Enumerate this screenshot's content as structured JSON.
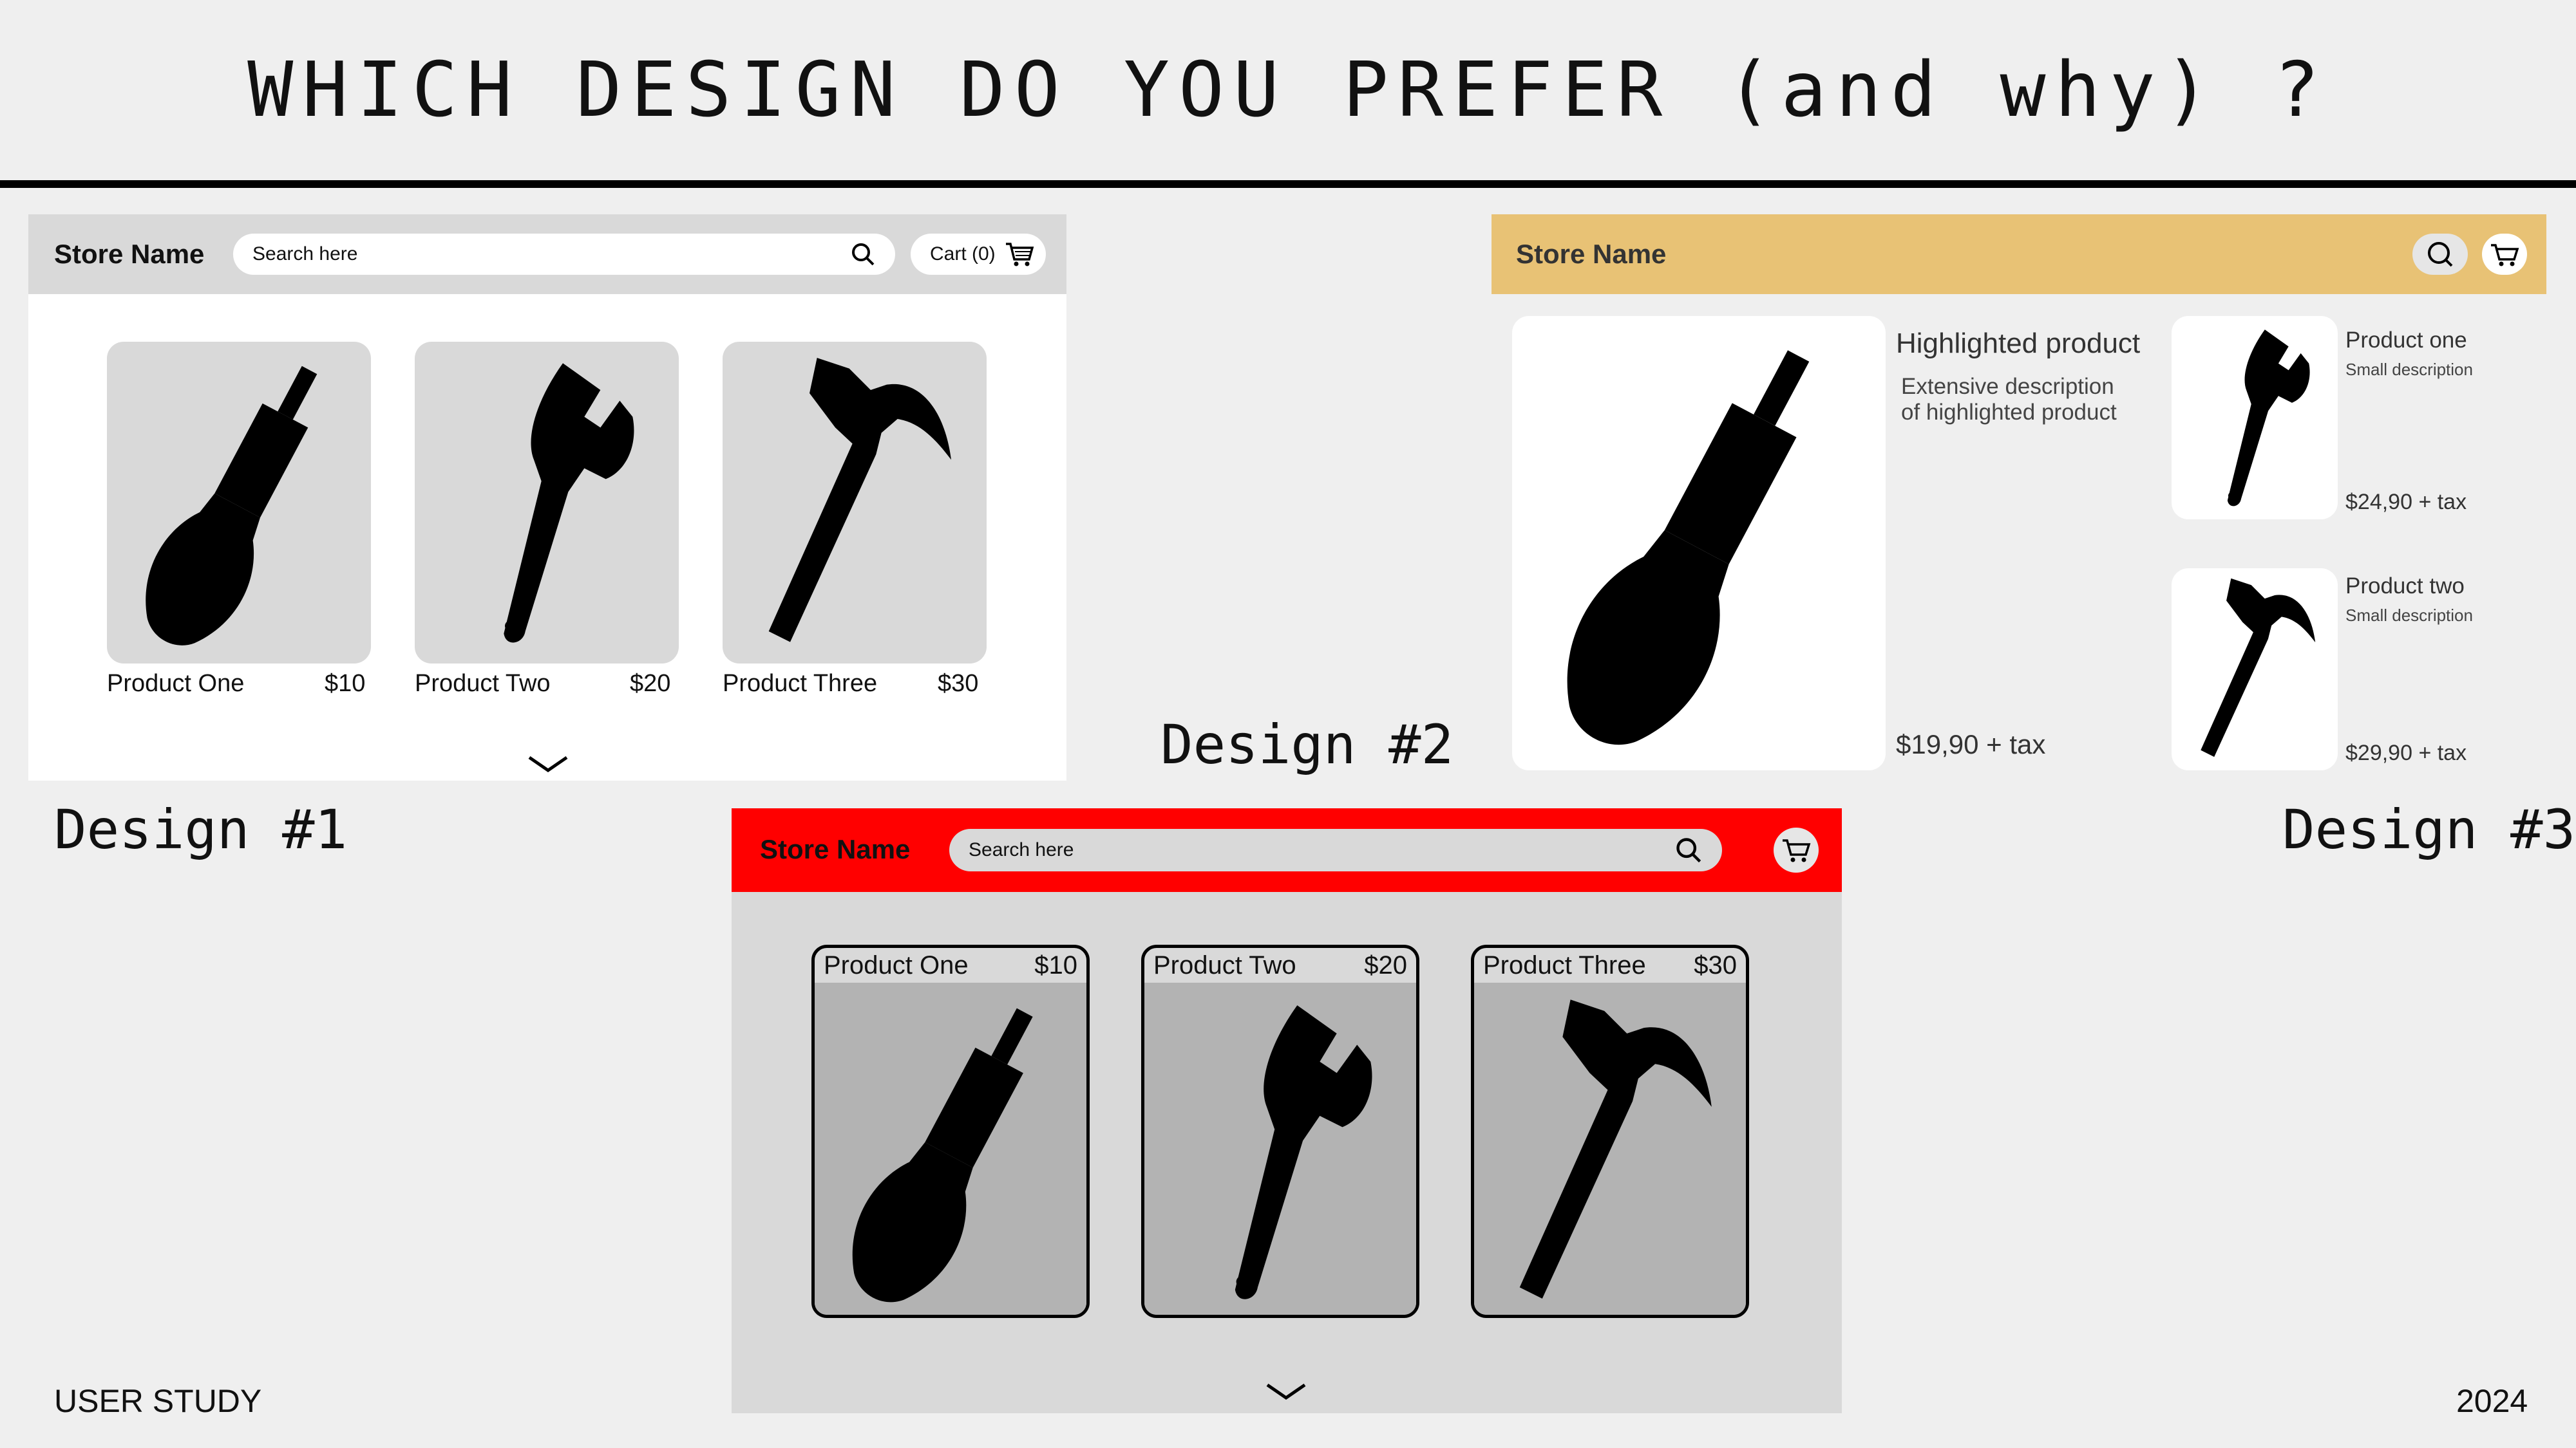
{
  "title": "WHICH DESIGN DO YOU PREFER (and why) ?",
  "labels": {
    "design1": "Design #1",
    "design2": "Design #2",
    "design3": "Design #3"
  },
  "footer": {
    "left": "USER STUDY",
    "right": "2024"
  },
  "design1": {
    "store_name": "Store Name",
    "search_placeholder": "Search here",
    "cart_label": "Cart (0)",
    "products": [
      {
        "name": "Product One",
        "price": "$10",
        "icon": "screwdriver-icon"
      },
      {
        "name": "Product Two",
        "price": "$20",
        "icon": "wrench-icon"
      },
      {
        "name": "Product Three",
        "price": "$30",
        "icon": "hammer-icon"
      }
    ],
    "colors": {
      "header": "#d9d9d9",
      "card": "#d9d9d9",
      "background": "#ffffff"
    }
  },
  "design2": {
    "store_name": "Store Name",
    "search_placeholder": "Search here",
    "products": [
      {
        "name": "Product One",
        "price": "$10",
        "icon": "screwdriver-icon"
      },
      {
        "name": "Product Two",
        "price": "$20",
        "icon": "wrench-icon"
      },
      {
        "name": "Product Three",
        "price": "$30",
        "icon": "hammer-icon"
      }
    ],
    "colors": {
      "header": "#ff0000",
      "card_image": "#b3b3b3",
      "background": "#d9d9d9"
    }
  },
  "design3": {
    "store_name": "Store Name",
    "highlighted": {
      "title": "Highlighted product",
      "description_line1": "Extensive description",
      "description_line2": "of highlighted product",
      "price": "$19,90 + tax",
      "icon": "screwdriver-icon"
    },
    "products": [
      {
        "name": "Product one",
        "description": "Small description",
        "price": "$24,90 + tax",
        "icon": "wrench-icon"
      },
      {
        "name": "Product two",
        "description": "Small description",
        "price": "$29,90 + tax",
        "icon": "hammer-icon"
      }
    ],
    "colors": {
      "header": "#e8c275"
    }
  }
}
